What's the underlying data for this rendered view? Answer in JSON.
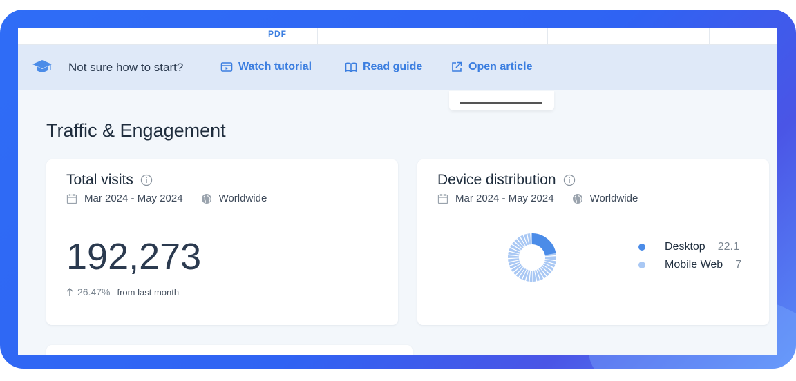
{
  "topbar": {
    "fragment": "PDF"
  },
  "banner": {
    "prompt": "Not sure how to start?",
    "links": [
      {
        "label": "Watch tutorial",
        "icon": "video-icon"
      },
      {
        "label": "Read guide",
        "icon": "book-icon"
      },
      {
        "label": "Open article",
        "icon": "external-link-icon"
      }
    ]
  },
  "section": {
    "title": "Traffic & Engagement"
  },
  "total_visits": {
    "title": "Total visits",
    "date_range": "Mar 2024 - May 2024",
    "region": "Worldwide",
    "value": "192,273",
    "change": "26.47%",
    "change_label": "from last month"
  },
  "device_distribution": {
    "title": "Device distribution",
    "date_range": "Mar 2024 - May 2024",
    "region": "Worldwide",
    "legend": [
      {
        "label": "Desktop",
        "value": "22.1",
        "color": "#4b8ce8"
      },
      {
        "label": "Mobile Web",
        "value": "7",
        "color": "#a9c8f4"
      }
    ],
    "donut": {
      "desktop_share": 0.221,
      "mobile_share": 0.779
    }
  },
  "colors": {
    "accent": "#3b7ee0",
    "frame": "#2f6df6",
    "banner": "#dfe9f8"
  }
}
